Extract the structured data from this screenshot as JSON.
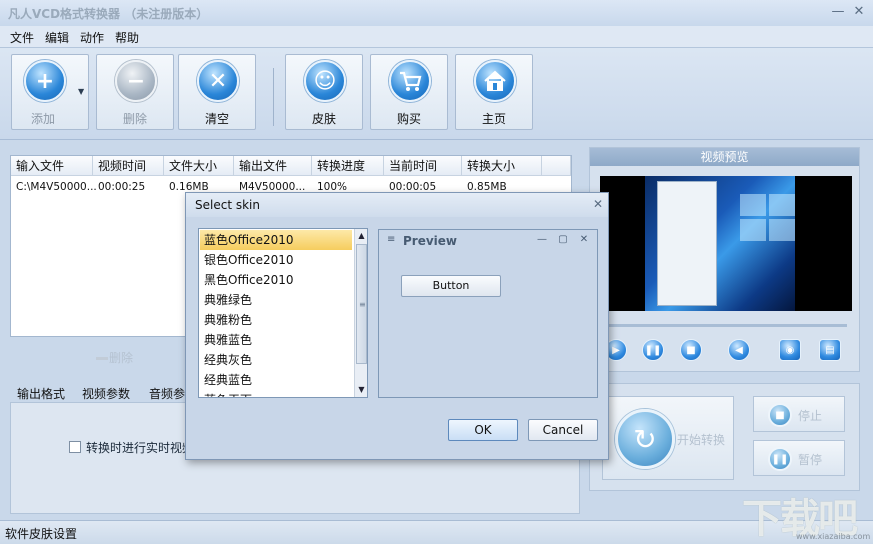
{
  "app": {
    "title": "凡人VCD格式转换器 （未注册版本）",
    "minimize": "—",
    "close": "✕"
  },
  "menu": [
    "文件",
    "编辑",
    "动作",
    "帮助"
  ],
  "toolbar": {
    "add": "添加",
    "delete": "删除",
    "clear": "清空",
    "skin": "皮肤",
    "buy": "购买",
    "home": "主页"
  },
  "file_table": {
    "columns": [
      "输入文件",
      "视频时间",
      "文件大小",
      "输出文件",
      "转换进度",
      "当前时间",
      "转换大小"
    ],
    "rows": [
      [
        "C:\\M4V50000...",
        "00:00:25",
        "0.16MB",
        "M4V50000...",
        "100%",
        "00:00:05",
        "0.85MB"
      ]
    ]
  },
  "list_delete": "删除",
  "tabs": [
    "输出格式",
    "视频参数",
    "音频参"
  ],
  "realtime_checkbox": "转换时进行实时视频",
  "preview": {
    "title": "视频预览"
  },
  "convert": {
    "start": "开始转换",
    "stop": "停止",
    "pause": "暂停"
  },
  "status": "软件皮肤设置",
  "watermark": {
    "logo": "下载吧",
    "url": "www.xiazaiba.com"
  },
  "dialog": {
    "title": "Select skin",
    "close": "✕",
    "skins": [
      "蓝色Office2010",
      "银色Office2010",
      "黑色Office2010",
      "典雅绿色",
      "典雅粉色",
      "典雅蓝色",
      "经典灰色",
      "经典蓝色",
      "蓝色天下"
    ],
    "selected_index": 0,
    "preview_title": "Preview",
    "preview_button": "Button",
    "ok": "OK",
    "cancel": "Cancel"
  },
  "colors": {
    "accent": "#2a86d8",
    "selection": "#f6cd5e",
    "background": "#c9d8ea"
  }
}
